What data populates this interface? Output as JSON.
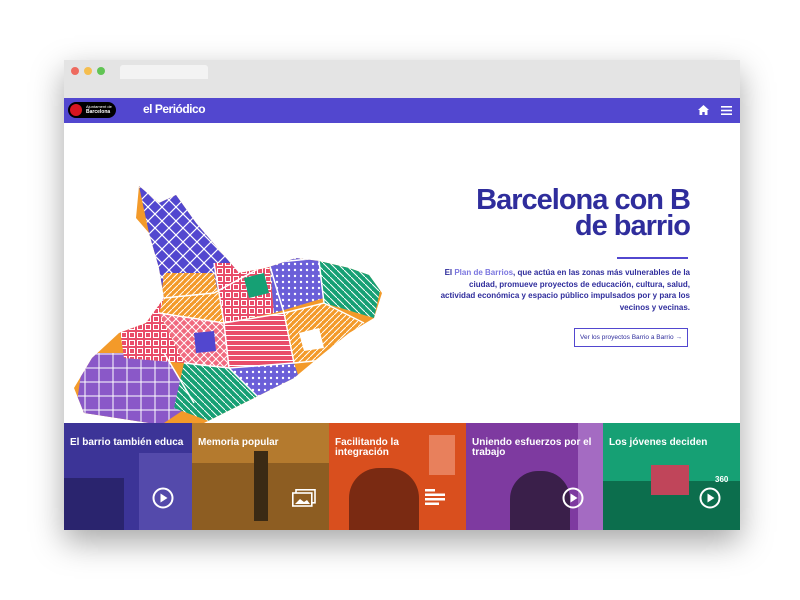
{
  "nav": {
    "ajuntament_line1": "Ajuntament de",
    "ajuntament_line2": "Barcelona",
    "logo": "el Periódico",
    "home_icon": "home-icon",
    "menu_icon": "hamburger-menu-icon"
  },
  "hero": {
    "title_line1": "Barcelona con B",
    "title_line2": "de barrio",
    "desc_pre": "El ",
    "desc_link": "Plan de Barrios",
    "desc_post": ", que actúa en las zonas más vulnerables de la ciudad, promueve proyectos de educación, cultura, salud, actividad económica y espacio público impulsados por y para los vecinos y vecinas.",
    "cta": "Ver los proyectos Barrio a Barrio"
  },
  "cards": [
    {
      "label": "El barrio también educa",
      "icon": "play-icon"
    },
    {
      "label": "Memoria popular",
      "icon": "gallery-icon"
    },
    {
      "label": "Facilitando la integración",
      "icon": "article-icon"
    },
    {
      "label": "Uniendo esfuerzos por el trabajo",
      "icon": "play-icon"
    },
    {
      "label": "Los jóvenes deciden",
      "icon": "play-360-icon",
      "badge": "360"
    }
  ],
  "colors": {
    "brand": "#5247cf",
    "title": "#2f2d9c",
    "map_palette": [
      "#5247cf",
      "#e94d6a",
      "#f39a2a",
      "#8a58c8",
      "#16a074",
      "#f06a7f",
      "#6b5fd8"
    ]
  }
}
